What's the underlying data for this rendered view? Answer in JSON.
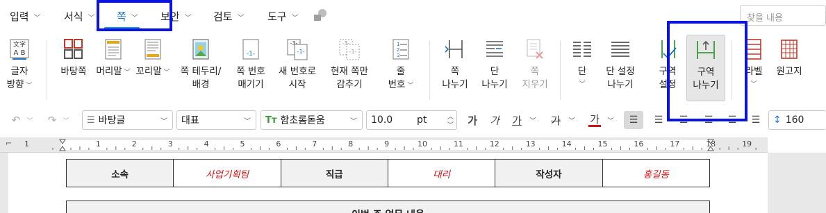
{
  "menu": {
    "tabs": [
      {
        "label": "입력"
      },
      {
        "label": "서식"
      },
      {
        "label": "쪽"
      },
      {
        "label": "보안"
      },
      {
        "label": "검토"
      },
      {
        "label": "도구"
      }
    ],
    "search_placeholder": "찾을 내용"
  },
  "ribbon": {
    "text_direction": [
      "글자",
      "방향"
    ],
    "background_page": "바탕쪽",
    "header": "머리말",
    "footer": "꼬리말",
    "page_border": [
      "쪽 테두리/",
      "배경"
    ],
    "page_number": [
      "쪽 번호",
      "매기기"
    ],
    "new_number": [
      "새 번호로",
      "시작"
    ],
    "hide_page": [
      "현재 쪽만",
      "감추기"
    ],
    "line_number": [
      "줄",
      "번호"
    ],
    "page_break": [
      "쪽",
      "나누기"
    ],
    "column_break": [
      "단",
      "나누기"
    ],
    "page_delete": [
      "쪽",
      "지우기"
    ],
    "column": "단",
    "column_setting": [
      "단 설정",
      "나누기"
    ],
    "section_setting": [
      "구역",
      "설정"
    ],
    "section_break": [
      "구역",
      "나누기"
    ],
    "label": "라벨",
    "manuscript": "원고지"
  },
  "format": {
    "style": "바탕글",
    "language": "대표",
    "font": "함초롬돋움",
    "font_size": "10.0",
    "unit": "pt",
    "line_spacing": "160"
  },
  "ruler": {
    "numbers": [
      "1",
      "1",
      "2",
      "3",
      "4",
      "5",
      "6",
      "7",
      "8",
      "9",
      "10",
      "11",
      "12",
      "13",
      "14",
      "15",
      "16",
      "17",
      "18",
      "19"
    ]
  },
  "document": {
    "table": [
      {
        "label": "소속",
        "value": "사업기획팀"
      },
      {
        "label": "직급",
        "value": "대리"
      },
      {
        "label": "작성자",
        "value": "홍길동"
      }
    ],
    "section_title": "이번 주 업무 내용"
  },
  "colors": {
    "accent": "#1a73c7",
    "highlight_box": "#0a14e0",
    "red_text": "#d01010"
  }
}
